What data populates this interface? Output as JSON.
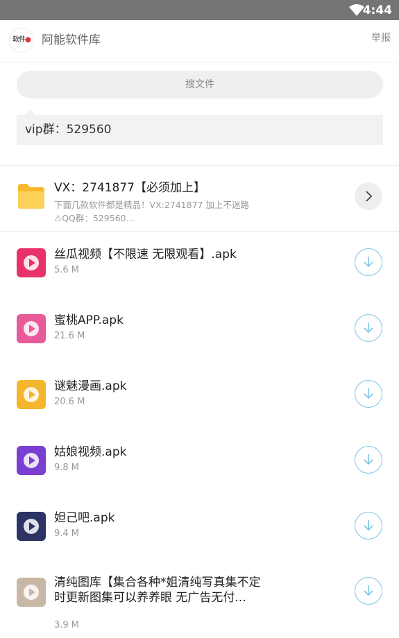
{
  "status_bar": {
    "time": "4:44"
  },
  "header": {
    "logo_text": "软件",
    "title": "阿能软件库",
    "report": "举报"
  },
  "search": {
    "placeholder": "搜文件"
  },
  "notice": {
    "text": "vip群：529560"
  },
  "folder": {
    "name": "VX：2741877【必须加上】",
    "description": "下面几款软件都是精品！VX:2741877 加上不迷路⚠QQ群：529560..."
  },
  "files": [
    {
      "name": "丝瓜视频【不限速 无限观看】.apk",
      "size": "5.6 M",
      "icon": "sigua-app-icon",
      "color": "#e8326b"
    },
    {
      "name": "蜜桃APP.apk",
      "size": "21.6 M",
      "icon": "mitao-app-icon",
      "color": "#e85a9a"
    },
    {
      "name": "谜魅漫画.apk",
      "size": "20.6 M",
      "icon": "mimei-app-icon",
      "color": "#f4b62c"
    },
    {
      "name": "姑娘视频.apk",
      "size": "9.8 M",
      "icon": "guniang-app-icon",
      "color": "#7a3fd0"
    },
    {
      "name": "妲己吧.apk",
      "size": "9.4 M",
      "icon": "daji-app-icon",
      "color": "#2c3466"
    },
    {
      "name": "清纯图库【集合各种*姐清纯写真集不定时更新图集可以养养眼 无广告无付...",
      "size": "3.9 M",
      "icon": "qingchun-app-icon",
      "color": "#c9b7a6"
    }
  ]
}
